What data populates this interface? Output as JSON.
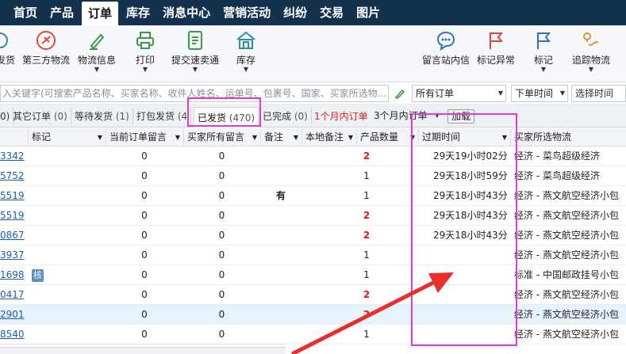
{
  "nav": {
    "tabs": [
      "首页",
      "产品",
      "订单",
      "库存",
      "消息中心",
      "营销活动",
      "纠纷",
      "交易",
      "图片"
    ],
    "active_index": 2
  },
  "toolbar": {
    "items": [
      "发货",
      "第三方物流",
      "物流信息",
      "打印",
      "提交速卖通",
      "库存",
      "留言站内信",
      "标记异常",
      "标记",
      "追踪物流"
    ],
    "colors": {
      "red": "#e0463c",
      "green": "#3a9a4a",
      "teal": "#2a8fa5",
      "blue": "#2d6fd3",
      "orange": "#e8902a"
    }
  },
  "search": {
    "placeholder": "入关键字(可搜索产品名称、买家名称、收件人姓名、运单号、包裹号、国家、买家所选物...",
    "order_filter": "所有订单",
    "time_filter": "下单时间",
    "time_range": "选择时间"
  },
  "filters": {
    "tabs": [
      {
        "label": "0)",
        "count": ""
      },
      {
        "label": "其它订单",
        "count": "(0)"
      },
      {
        "label": "等待发货",
        "count": "(1)"
      },
      {
        "label": "打包发货",
        "count": "(4"
      },
      {
        "label": "已发货",
        "count": "(470)"
      },
      {
        "label": "已完成",
        "count": "(0)"
      }
    ],
    "month_link": "1个月内订单",
    "range_select": "3个月内订单",
    "load_button": "加载"
  },
  "table": {
    "columns": [
      "标记",
      "当前订单留言",
      "买家所有留言",
      "备注",
      "本地备注",
      "产品数量",
      "过期时间",
      "买家所选物流"
    ],
    "rows": [
      {
        "id": "3342",
        "mark": "",
        "cur_msg": "0",
        "buyer_msg": "0",
        "note": "",
        "qty": "2",
        "qty_red": true,
        "expire": "29天19小时02分",
        "logistics": "经济 - 菜鸟超级经济"
      },
      {
        "id": "5752",
        "mark": "",
        "cur_msg": "0",
        "buyer_msg": "0",
        "note": "",
        "qty": "1",
        "qty_red": false,
        "expire": "29天18小时59分",
        "logistics": "经济 - 菜鸟超级经济"
      },
      {
        "id": "5519",
        "mark": "",
        "cur_msg": "0",
        "buyer_msg": "0",
        "note": "有",
        "qty": "1",
        "qty_red": false,
        "expire": "29天18小时43分",
        "logistics": "经济 - 燕文航空经济小包"
      },
      {
        "id": "5519",
        "mark": "",
        "cur_msg": "0",
        "buyer_msg": "0",
        "note": "",
        "qty": "2",
        "qty_red": true,
        "expire": "29天18小时43分",
        "logistics": "经济 - 燕文航空经济小包"
      },
      {
        "id": "0867",
        "mark": "",
        "cur_msg": "0",
        "buyer_msg": "0",
        "note": "",
        "qty": "2",
        "qty_red": true,
        "expire": "29天18小时43分",
        "logistics": "经济 - 燕文航空经济小包"
      },
      {
        "id": "3937",
        "mark": "",
        "cur_msg": "0",
        "buyer_msg": "0",
        "note": "",
        "qty": "1",
        "qty_red": false,
        "expire": "",
        "logistics": "经济 - 燕文航空经济小包"
      },
      {
        "id": "1698",
        "mark": "核",
        "cur_msg": "0",
        "buyer_msg": "0",
        "note": "",
        "qty": "1",
        "qty_red": false,
        "expire": "",
        "logistics": "标准 - 中国邮政挂号小包"
      },
      {
        "id": "0417",
        "mark": "",
        "cur_msg": "0",
        "buyer_msg": "0",
        "note": "",
        "qty": "2",
        "qty_red": true,
        "expire": "",
        "logistics": "经济 - 燕文航空经济小包"
      },
      {
        "id": "2901",
        "mark": "",
        "cur_msg": "0",
        "buyer_msg": "0",
        "note": "",
        "qty": "2",
        "qty_red": true,
        "expire": "",
        "logistics": "经济 - 燕文航空经济小包"
      },
      {
        "id": "8540",
        "mark": "",
        "cur_msg": "0",
        "buyer_msg": "0",
        "note": "",
        "qty": "1",
        "qty_red": false,
        "expire": "",
        "logistics": "经济 - 燕文航空经济小包"
      }
    ],
    "highlight_row": 8
  },
  "annotations": {
    "color": "#e03ad6",
    "arrow_color": "#e8302a"
  }
}
